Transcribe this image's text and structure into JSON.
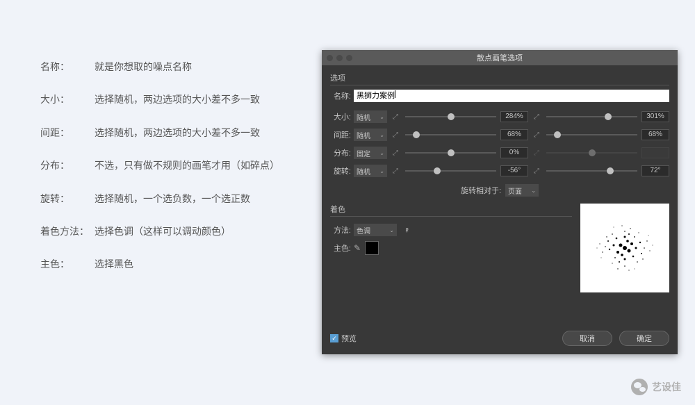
{
  "explanation": {
    "items": [
      {
        "label": "名称：",
        "text": "就是你想取的噪点名称"
      },
      {
        "label": "大小：",
        "text": "选择随机，两边选项的大小差不多一致"
      },
      {
        "label": "间距：",
        "text": "选择随机，两边选项的大小差不多一致"
      },
      {
        "label": "分布：",
        "text": "不选，只有做不规则的画笔才用（如碎点）"
      },
      {
        "label": "旋转：",
        "text": "选择随机，一个选负数，一个选正数"
      },
      {
        "label": "着色方法：",
        "text": "选择色调（这样可以调动颜色）"
      },
      {
        "label": "主色：",
        "text": "选择黑色"
      }
    ]
  },
  "dialog": {
    "title": "散点画笔选项",
    "options_label": "选项",
    "name_label": "名称:",
    "name_value": "黑狮力案例",
    "rows": {
      "size": {
        "label": "大小:",
        "mode": "随机",
        "val1": "284%",
        "val2": "301%",
        "t1": 50,
        "t2": 68,
        "disabled": false,
        "link": true
      },
      "spacing": {
        "label": "间距:",
        "mode": "随机",
        "val1": "68%",
        "val2": "68%",
        "t1": 12,
        "t2": 12,
        "disabled": false,
        "link": true
      },
      "scatter": {
        "label": "分布:",
        "mode": "固定",
        "val1": "0%",
        "val2": "",
        "t1": 50,
        "t2": 50,
        "disabled": true,
        "link": false
      },
      "rotation": {
        "label": "旋转:",
        "mode": "随机",
        "val1": "-56°",
        "val2": "72°",
        "t1": 35,
        "t2": 70,
        "disabled": false,
        "link": true
      }
    },
    "relative_label": "旋转相对于:",
    "relative_value": "页面",
    "coloring_label": "着色",
    "method_label": "方法:",
    "method_value": "色调",
    "maincolor_label": "主色:",
    "preview_label": "预览",
    "cancel": "取消",
    "ok": "确定"
  },
  "watermark": "艺设佳"
}
